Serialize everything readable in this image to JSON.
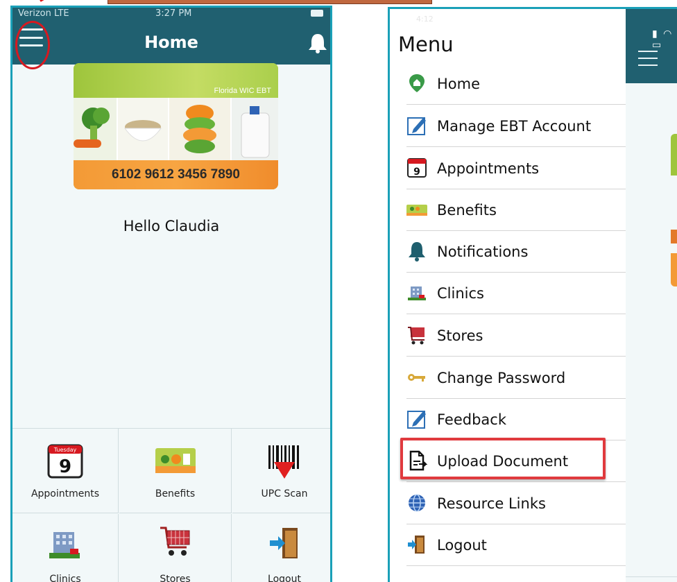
{
  "left_screen": {
    "status": {
      "carrier": "Verizon  LTE",
      "time": "3:27 PM"
    },
    "title": "Home",
    "card": {
      "brand": "Florida WIC EBT",
      "number": "6102 9612 3456 7890"
    },
    "greeting": "Hello Claudia",
    "calendar": {
      "day": "Tuesday",
      "date": "9"
    },
    "grid": [
      {
        "label": "Appointments",
        "icon": "calendar-icon"
      },
      {
        "label": "Benefits",
        "icon": "benefits-card-icon"
      },
      {
        "label": "UPC Scan",
        "icon": "barcode-scan-icon"
      },
      {
        "label": "Clinics",
        "icon": "clinic-building-icon"
      },
      {
        "label": "Stores",
        "icon": "shopping-cart-icon"
      },
      {
        "label": "Logout",
        "icon": "logout-door-icon"
      }
    ]
  },
  "right_screen": {
    "status": {
      "time": "4:12"
    },
    "menu_title": "Menu",
    "calendar_date": "9",
    "items": [
      {
        "label": "Home",
        "icon": "home-pin-icon"
      },
      {
        "label": "Manage EBT Account",
        "icon": "edit-icon"
      },
      {
        "label": "Appointments",
        "icon": "calendar-icon"
      },
      {
        "label": "Benefits",
        "icon": "benefits-card-icon"
      },
      {
        "label": "Notifications",
        "icon": "bell-icon"
      },
      {
        "label": "Clinics",
        "icon": "clinic-building-icon"
      },
      {
        "label": "Stores",
        "icon": "shopping-cart-icon"
      },
      {
        "label": "Change Password",
        "icon": "key-icon"
      },
      {
        "label": "Feedback",
        "icon": "edit-icon"
      },
      {
        "label": "Upload Document",
        "icon": "upload-document-icon"
      },
      {
        "label": "Resource Links",
        "icon": "globe-icon"
      },
      {
        "label": "Logout",
        "icon": "logout-door-icon"
      }
    ]
  },
  "colors": {
    "header": "#206070",
    "frame": "#1aa0b8",
    "annotation_red": "#d71920",
    "card_green": "#9ec53c",
    "card_orange": "#f39a36"
  }
}
